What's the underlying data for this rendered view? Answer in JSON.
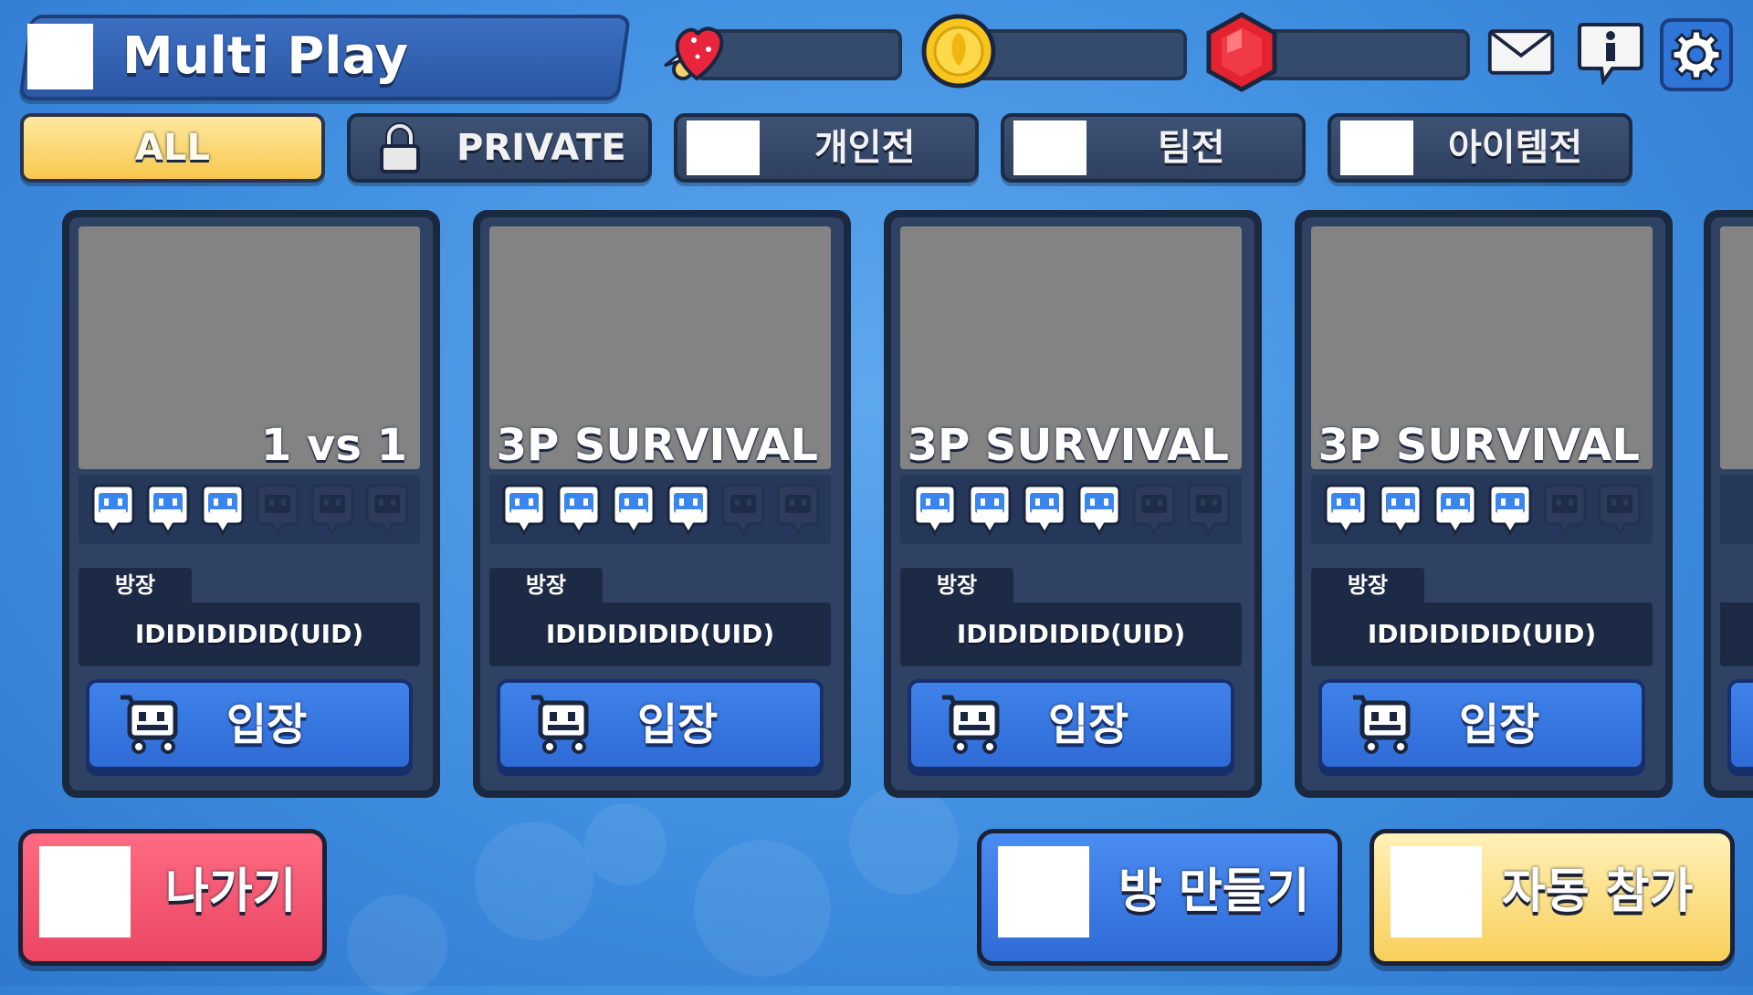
{
  "title": {
    "text": "Multi Play"
  },
  "top_buttons": {
    "mail": "mail-icon",
    "info": "info-icon",
    "settings": "gear-icon"
  },
  "resources": [
    {
      "name": "heart-key",
      "icon": "heart-key-icon",
      "value": ""
    },
    {
      "name": "gold-coin",
      "icon": "gold-coin-icon",
      "value": ""
    },
    {
      "name": "ruby-gem",
      "icon": "ruby-gem-icon",
      "value": ""
    }
  ],
  "tabs": [
    {
      "label": "ALL",
      "active": true
    },
    {
      "label": "PRIVATE",
      "icon": "lock-icon"
    },
    {
      "label": "개인전"
    },
    {
      "label": "팀전"
    },
    {
      "label": "아이템전"
    }
  ],
  "rooms": [
    {
      "mode": "1 vs 1",
      "filled_slots": 3,
      "total_slots": 6,
      "owner_label": "방장",
      "owner": "IDIDIDIDID(UID)",
      "enter_label": "입장"
    },
    {
      "mode": "3P SURVIVAL",
      "filled_slots": 4,
      "total_slots": 6,
      "owner_label": "방장",
      "owner": "IDIDIDIDID(UID)",
      "enter_label": "입장"
    },
    {
      "mode": "3P SURVIVAL",
      "filled_slots": 4,
      "total_slots": 6,
      "owner_label": "방장",
      "owner": "IDIDIDIDID(UID)",
      "enter_label": "입장"
    },
    {
      "mode": "3P SURVIVAL",
      "filled_slots": 4,
      "total_slots": 6,
      "owner_label": "방장",
      "owner": "IDIDIDIDID(UID)",
      "enter_label": "입장"
    }
  ],
  "bottom": {
    "exit_label": "나가기",
    "create_label": "방 만들기",
    "auto_join_label": "자동 참가"
  },
  "colors": {
    "background": "#3f8ee0",
    "tab_active": "#f7c84e",
    "enter_button": "#2f6bd6",
    "exit_button": "#ea4663",
    "create_button": "#2f6bd6",
    "auto_join_button": "#f8cf5a",
    "player_slot_filled": "#2f7be8"
  }
}
